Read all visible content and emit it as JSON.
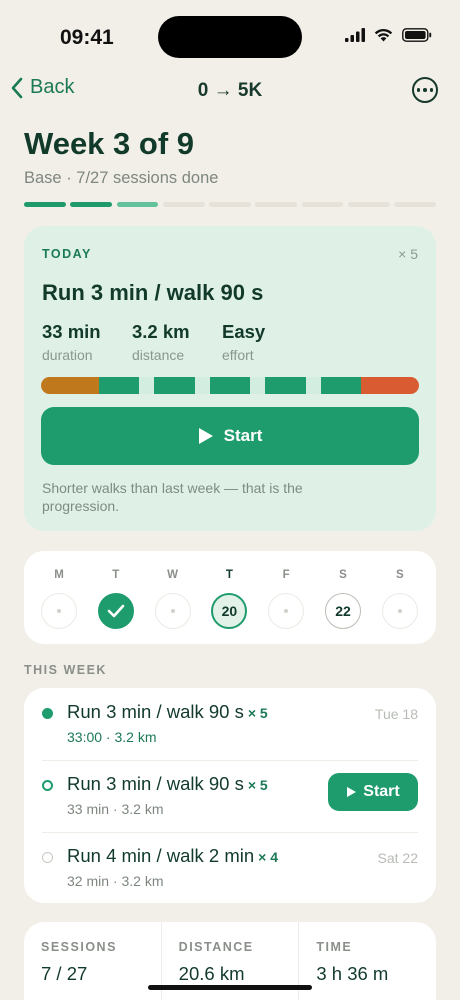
{
  "status": {
    "time": "09:41"
  },
  "nav": {
    "back_label": "Back",
    "title": "0 → 5K"
  },
  "header": {
    "title": "Week 3 of 9",
    "subtitle": "Base · 7/27 sessions done"
  },
  "week_progress": {
    "total_weeks": 9,
    "done_weeks": 2,
    "current_week": 3
  },
  "today": {
    "label": "TODAY",
    "reps": "× 5",
    "title": "Run 3 min / walk 90 s",
    "stats": [
      {
        "value": "33 min",
        "label": "duration"
      },
      {
        "value": "3.2 km",
        "label": "distance"
      },
      {
        "value": "Easy",
        "label": "effort"
      }
    ],
    "start_label": "Start",
    "note": "Shorter walks than last week — that is the progression.",
    "colors": {
      "warmup": "#c0781c",
      "run": "#1f9c6d",
      "walk": "#d4ede1",
      "cooldown": "#d95b32"
    }
  },
  "week_strip": [
    {
      "letter": "M",
      "state": "rest",
      "num": ""
    },
    {
      "letter": "T",
      "state": "done",
      "num": ""
    },
    {
      "letter": "W",
      "state": "rest",
      "num": ""
    },
    {
      "letter": "T",
      "state": "today",
      "num": "20"
    },
    {
      "letter": "F",
      "state": "rest",
      "num": ""
    },
    {
      "letter": "S",
      "state": "planned",
      "num": "22"
    },
    {
      "letter": "S",
      "state": "rest",
      "num": ""
    }
  ],
  "this_week": {
    "label": "THIS WEEK",
    "sessions": [
      {
        "title": "Run 3 min / walk 90 s",
        "mult": "× 5",
        "sub": "33:00 · 3.2 km",
        "date": "Tue 18",
        "state": "done"
      },
      {
        "title": "Run 3 min / walk 90 s",
        "mult": "× 5",
        "sub": "33 min · 3.2 km",
        "action": "Start",
        "state": "today"
      },
      {
        "title": "Run 4 min / walk 2 min",
        "mult": "× 4",
        "sub": "32 min · 3.2 km",
        "date": "Sat 22",
        "state": "upcoming"
      }
    ]
  },
  "summary": [
    {
      "label": "SESSIONS",
      "value": "7 / 27"
    },
    {
      "label": "DISTANCE",
      "value": "20.6 km"
    },
    {
      "label": "TIME",
      "value": "3 h 36 m"
    }
  ]
}
